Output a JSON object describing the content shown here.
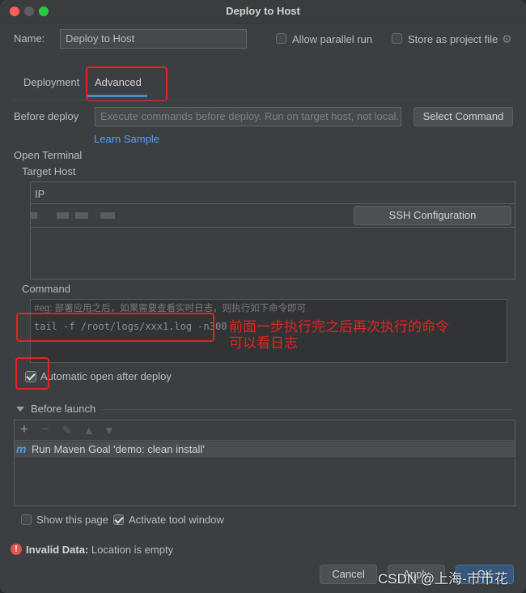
{
  "window": {
    "title": "Deploy to Host"
  },
  "name_field": {
    "label": "Name:",
    "value": "Deploy to Host"
  },
  "options": {
    "allow_parallel": "Allow parallel run",
    "store_project": "Store as project file"
  },
  "tabs": [
    {
      "label": "Deployment"
    },
    {
      "label": "Advanced"
    }
  ],
  "before_deploy": {
    "label": "Before deploy",
    "placeholder": "Execute commands before deploy. Run on target host, not local.",
    "select_button": "Select Command",
    "learn_link": "Learn Sample"
  },
  "open_terminal": {
    "label": "Open Terminal",
    "target_host_label": "Target Host",
    "ip_header": "IP",
    "ssh_button": "SSH Configuration",
    "command_label": "Command",
    "comment_line": "#eg: 部署应用之后，如果需要查看实时日志，则执行如下命令即可",
    "command_line": "tail -f /root/logs/xxx1.log -n300",
    "annotation": [
      "前面一步执行完之后再次执行的命令",
      "可以看日志"
    ],
    "auto_open_label": "Automatic open after deploy",
    "auto_open_checked": true
  },
  "before_launch": {
    "label": "Before launch",
    "item": "Run Maven Goal 'demo: clean install'"
  },
  "bottom_options": {
    "show_page": "Show this page",
    "show_page_checked": false,
    "activate_tool": "Activate tool window",
    "activate_tool_checked": true
  },
  "error": {
    "title": "Invalid Data:",
    "message": "Location is empty"
  },
  "buttons": {
    "cancel": "Cancel",
    "apply": "Apply",
    "ok": "OK"
  },
  "watermark": "CSDN @上海-市市花",
  "colors": {
    "annotation_red": "#e52222",
    "link_blue": "#589df6",
    "primary": "#365880"
  }
}
